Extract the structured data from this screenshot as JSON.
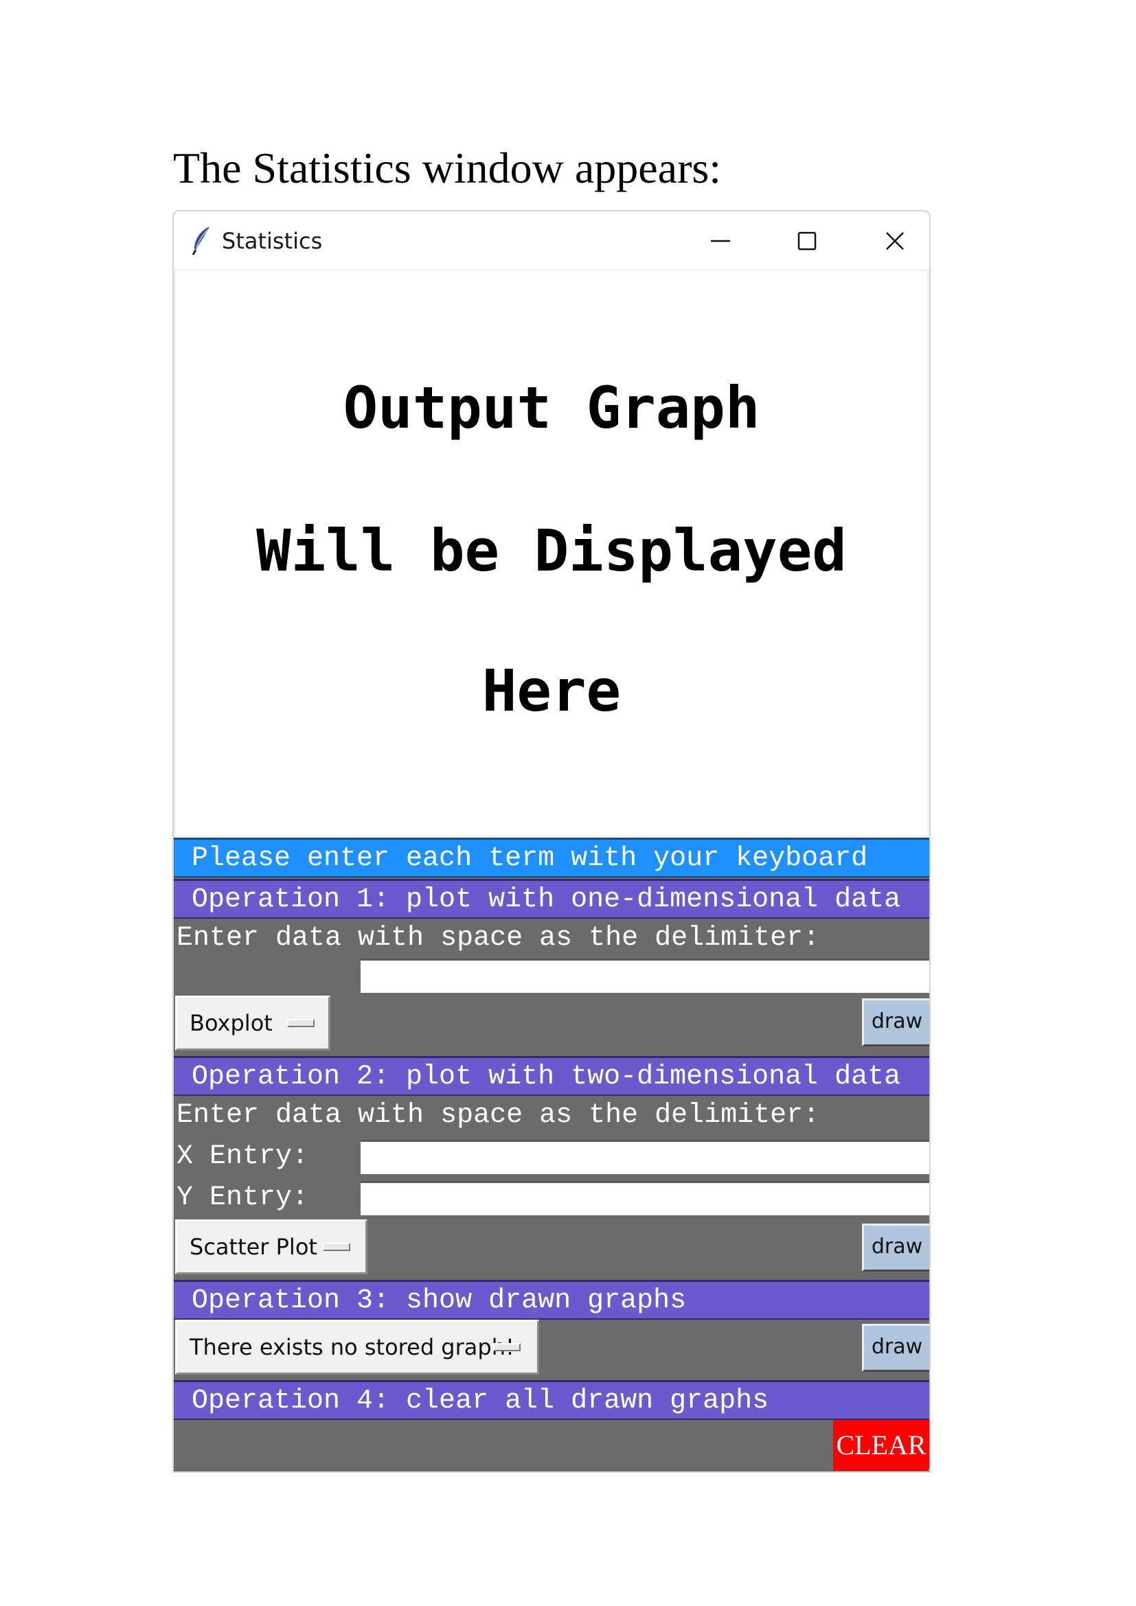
{
  "doc_caption": "The Statistics window appears:",
  "window": {
    "title": "Statistics",
    "icon": "feather-icon",
    "controls": [
      "minimize-icon",
      "maximize-icon",
      "close-icon"
    ]
  },
  "graph_area": {
    "line1": "Output Graph",
    "line2": "Will be Displayed",
    "line3": "Here"
  },
  "instruction_banner": "Please enter each term with your keyboard",
  "operation1": {
    "heading": "Operation 1: plot with one-dimensional data",
    "prompt": "Enter data with space as the delimiter:",
    "entry_value": "",
    "plot_type": "Boxplot",
    "draw_label": "draw"
  },
  "operation2": {
    "heading": "Operation 2: plot with two-dimensional data",
    "prompt": "Enter data with space as the delimiter:",
    "x_label": "X Entry:",
    "x_value": "",
    "y_label": "Y Entry:",
    "y_value": "",
    "plot_type": "Scatter Plot",
    "draw_label": "draw"
  },
  "operation3": {
    "heading": "Operation 3: show drawn graphs",
    "graph_select": "There exists no stored graph!",
    "draw_label": "draw"
  },
  "operation4": {
    "heading": "Operation 4: clear all drawn graphs",
    "clear_label": "CLEAR"
  },
  "colors": {
    "panel_bg": "#6b6b6b",
    "banner_blue": "#1e90ff",
    "banner_purple": "#6a5acd",
    "draw_button": "#b0c4de",
    "clear_button": "#ff0000"
  }
}
